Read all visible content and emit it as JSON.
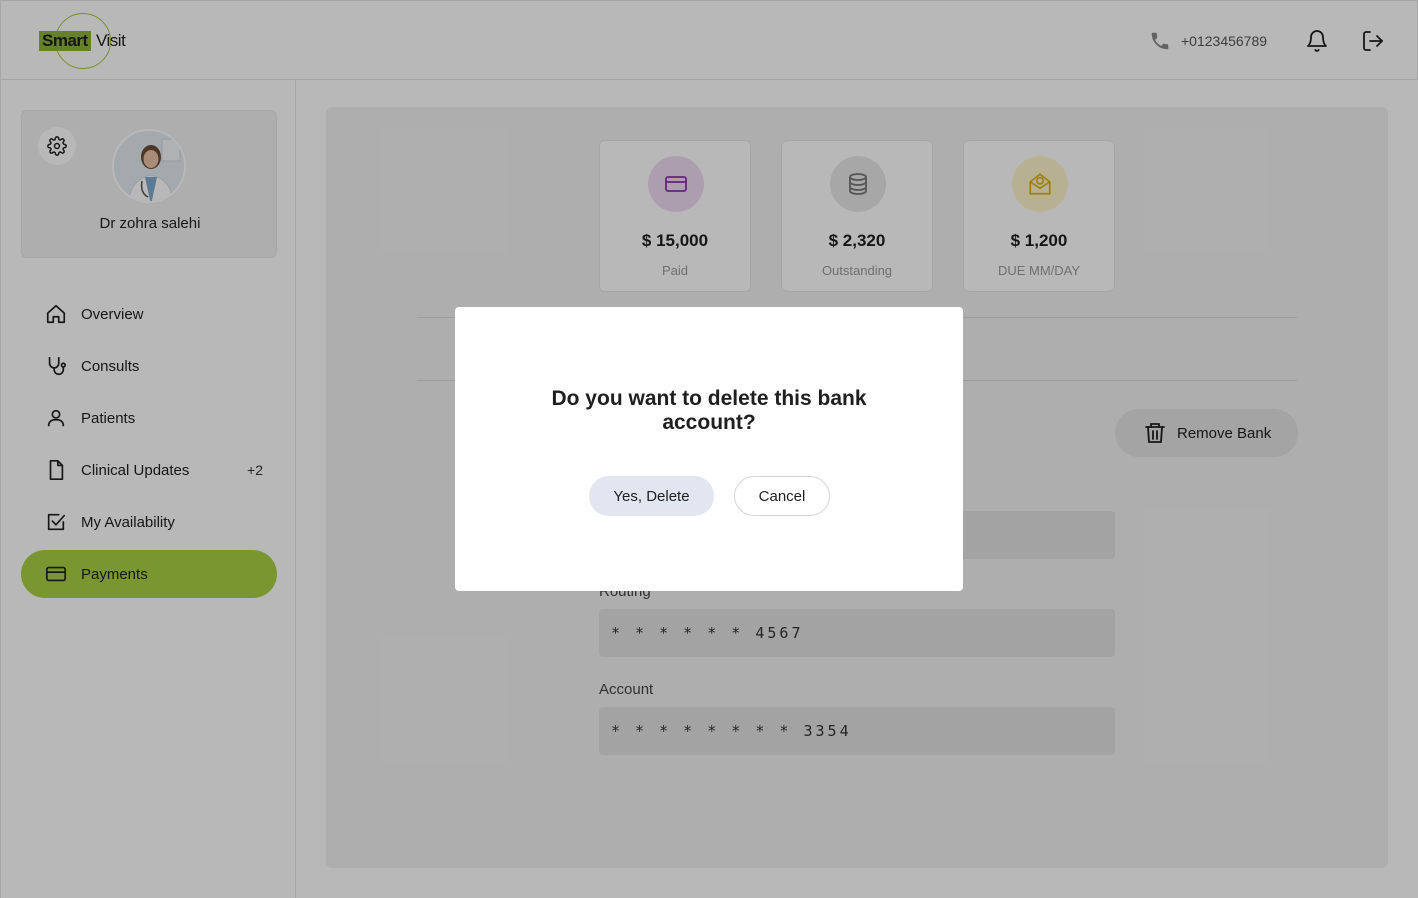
{
  "header": {
    "logo_text_a": "Smart",
    "logo_text_b": "Visit",
    "phone": "+0123456789",
    "phone_icon": "phone-icon",
    "bell_icon": "bell-icon",
    "logout_icon": "logout-icon"
  },
  "profile": {
    "name": "Dr zohra salehi",
    "settings_icon": "gear-icon"
  },
  "sidebar": {
    "items": [
      {
        "label": "Overview",
        "icon": "home-icon"
      },
      {
        "label": "Consults",
        "icon": "stethoscope-icon"
      },
      {
        "label": "Patients",
        "icon": "user-icon"
      },
      {
        "label": "Clinical Updates",
        "icon": "document-icon",
        "badge": "+2"
      },
      {
        "label": "My Availability",
        "icon": "checkbox-icon"
      },
      {
        "label": "Payments",
        "icon": "card-icon",
        "active": true
      }
    ]
  },
  "stats": [
    {
      "value": "$ 15,000",
      "label": "Paid",
      "icon": "card-icon",
      "color": "#8e2fb0",
      "bg": "#f0dcf3"
    },
    {
      "value": "$ 2,320",
      "label": "Outstanding",
      "icon": "coins-icon",
      "color": "#777777",
      "bg": "#e8e8e8"
    },
    {
      "value": "$ 1,200",
      "label": "DUE MM/DAY",
      "icon": "money-envelope-icon",
      "color": "#e0b400",
      "bg": "#fff4cc"
    }
  ],
  "bank": {
    "remove_label": "Remove Bank",
    "routing_label": "Routing",
    "routing_value": "* * * * * * 4567",
    "account_label": "Account",
    "account_value": "* * * * * * * * 3354"
  },
  "modal": {
    "title": "Do you want to delete this bank account?",
    "confirm_label": "Yes, Delete",
    "cancel_label": "Cancel"
  },
  "colors": {
    "accent": "#a8d045",
    "logo_green": "#8db33a"
  }
}
